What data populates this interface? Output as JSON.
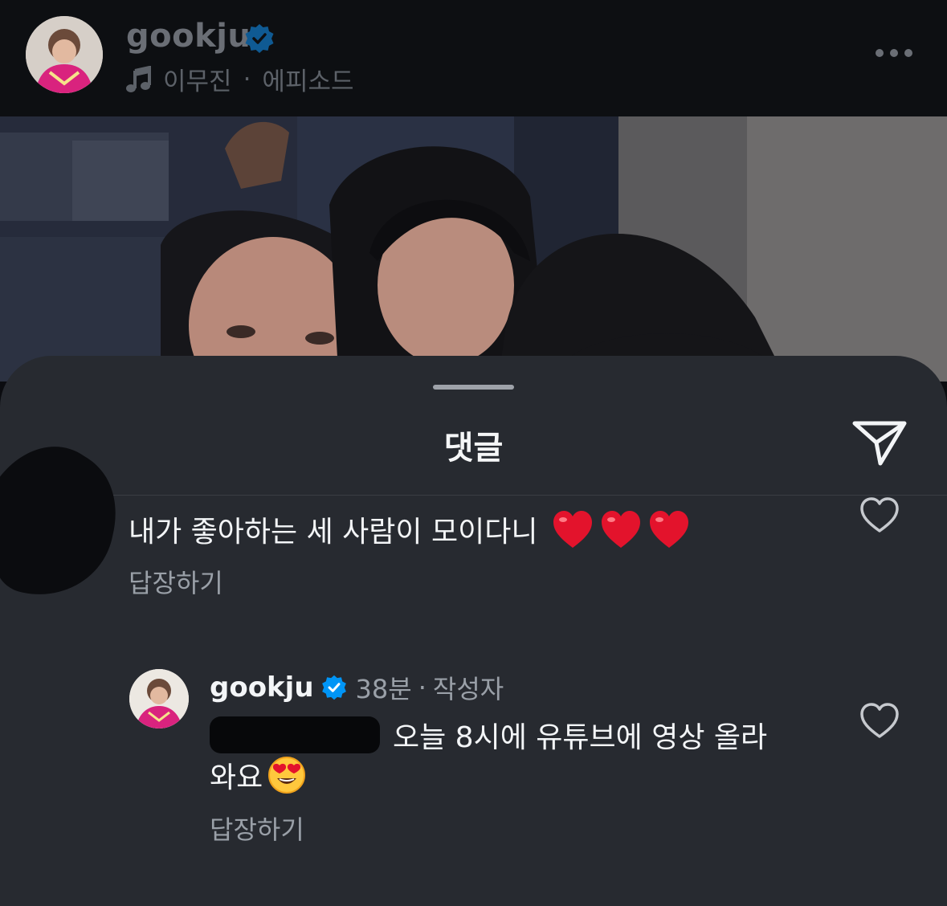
{
  "header": {
    "username": "gookju",
    "music_artist": "이무진",
    "music_separator": "·",
    "music_track": "에피소드"
  },
  "sheet": {
    "title": "댓글"
  },
  "comments": [
    {
      "text": "내가 좋아하는 세 사람이 모이다니",
      "reply_label": "답장하기"
    },
    {
      "username": "gookju",
      "time": "38분",
      "separator": "·",
      "author_badge": "작성자",
      "text_line1": "오늘 8시에 유튜브에 영상 올라",
      "text_line2": "와요",
      "reply_label": "답장하기"
    }
  ],
  "colors": {
    "sheet_bg": "#272a30",
    "verified_blue": "#0095f6",
    "heart_red": "#e3132c"
  }
}
